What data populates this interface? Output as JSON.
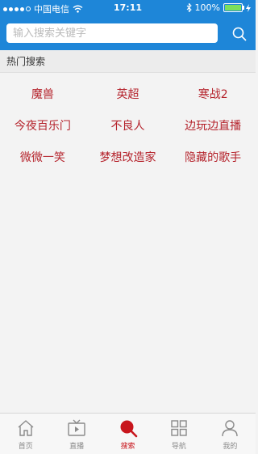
{
  "status_bar": {
    "carrier": "中国电信",
    "time": "17:11",
    "battery": "100%"
  },
  "search": {
    "placeholder": "输入搜索关键字",
    "button_icon": "search-icon"
  },
  "hot_search": {
    "title": "热门搜索",
    "rows": [
      [
        "魔兽",
        "英超",
        "寒战2"
      ],
      [
        "今夜百乐门",
        "不良人",
        "边玩边直播"
      ],
      [
        "微微一笑",
        "梦想改造家",
        "隐藏的歌手"
      ]
    ]
  },
  "bottom_nav": {
    "items": [
      {
        "label": "首页",
        "icon": "home-icon"
      },
      {
        "label": "直播",
        "icon": "tv-icon"
      },
      {
        "label": "搜索",
        "icon": "search-icon"
      },
      {
        "label": "导航",
        "icon": "grid-icon"
      },
      {
        "label": "我的",
        "icon": "user-icon"
      }
    ],
    "active_index": 2
  },
  "colors": {
    "header_blue": "#1e86d8",
    "accent_red": "#c8161d",
    "hot_text": "#b5232c"
  }
}
